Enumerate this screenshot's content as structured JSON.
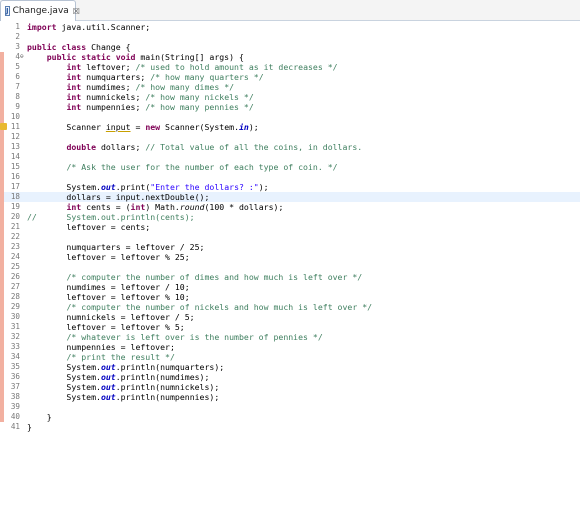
{
  "tab": {
    "title": "Change.java",
    "close": "☒"
  },
  "lines": [
    {
      "n": "1",
      "tokens": [
        {
          "t": "kw",
          "v": "import"
        },
        {
          "t": "p",
          "v": " java.util.Scanner;"
        }
      ]
    },
    {
      "n": "2",
      "tokens": []
    },
    {
      "n": "3",
      "tokens": [
        {
          "t": "kw",
          "v": "public class"
        },
        {
          "t": "p",
          "v": " Change {"
        }
      ]
    },
    {
      "n": "4",
      "fold": "⊖",
      "tokens": [
        {
          "t": "p",
          "v": "    "
        },
        {
          "t": "kw",
          "v": "public static void"
        },
        {
          "t": "p",
          "v": " main(String[] args) {"
        }
      ]
    },
    {
      "n": "5",
      "tokens": [
        {
          "t": "p",
          "v": "        "
        },
        {
          "t": "kw",
          "v": "int"
        },
        {
          "t": "p",
          "v": " leftover; "
        },
        {
          "t": "cm",
          "v": "/* used to hold amount as it decreases */"
        }
      ]
    },
    {
      "n": "6",
      "tokens": [
        {
          "t": "p",
          "v": "        "
        },
        {
          "t": "kw",
          "v": "int"
        },
        {
          "t": "p",
          "v": " numquarters; "
        },
        {
          "t": "cm",
          "v": "/* how many quarters */"
        }
      ]
    },
    {
      "n": "7",
      "tokens": [
        {
          "t": "p",
          "v": "        "
        },
        {
          "t": "kw",
          "v": "int"
        },
        {
          "t": "p",
          "v": " numdimes; "
        },
        {
          "t": "cm",
          "v": "/* how many dimes */"
        }
      ]
    },
    {
      "n": "8",
      "tokens": [
        {
          "t": "p",
          "v": "        "
        },
        {
          "t": "kw",
          "v": "int"
        },
        {
          "t": "p",
          "v": " numnickels; "
        },
        {
          "t": "cm",
          "v": "/* how many nickels */"
        }
      ]
    },
    {
      "n": "9",
      "tokens": [
        {
          "t": "p",
          "v": "        "
        },
        {
          "t": "kw",
          "v": "int"
        },
        {
          "t": "p",
          "v": " numpennies; "
        },
        {
          "t": "cm",
          "v": "/* how many pennies */"
        }
      ]
    },
    {
      "n": "10",
      "tokens": []
    },
    {
      "n": "11",
      "warn": true,
      "tokens": [
        {
          "t": "p",
          "v": "        Scanner "
        },
        {
          "t": "ul",
          "v": "input"
        },
        {
          "t": "p",
          "v": " = "
        },
        {
          "t": "kw",
          "v": "new"
        },
        {
          "t": "p",
          "v": " Scanner(System."
        },
        {
          "t": "sf",
          "v": "in"
        },
        {
          "t": "p",
          "v": ");"
        }
      ]
    },
    {
      "n": "12",
      "tokens": []
    },
    {
      "n": "13",
      "tokens": [
        {
          "t": "p",
          "v": "        "
        },
        {
          "t": "kw",
          "v": "double"
        },
        {
          "t": "p",
          "v": " dollars; "
        },
        {
          "t": "cm",
          "v": "// Total value of all the coins, in dollars."
        }
      ]
    },
    {
      "n": "14",
      "tokens": []
    },
    {
      "n": "15",
      "tokens": [
        {
          "t": "p",
          "v": "        "
        },
        {
          "t": "cm",
          "v": "/* Ask the user for the number of each type of coin. */"
        }
      ]
    },
    {
      "n": "16",
      "tokens": []
    },
    {
      "n": "17",
      "tokens": [
        {
          "t": "p",
          "v": "        System."
        },
        {
          "t": "sf",
          "v": "out"
        },
        {
          "t": "p",
          "v": ".print("
        },
        {
          "t": "st",
          "v": "\"Enter the dollars? :\""
        },
        {
          "t": "p",
          "v": ");"
        }
      ]
    },
    {
      "n": "18",
      "current": true,
      "tokens": [
        {
          "t": "p",
          "v": "        dollars = input.nextDouble();"
        }
      ]
    },
    {
      "n": "19",
      "tokens": [
        {
          "t": "p",
          "v": "        "
        },
        {
          "t": "kw",
          "v": "int"
        },
        {
          "t": "p",
          "v": " cents = ("
        },
        {
          "t": "kw",
          "v": "int"
        },
        {
          "t": "p",
          "v": ") Math."
        },
        {
          "t": "i",
          "v": "round"
        },
        {
          "t": "p",
          "v": "(100 * dollars);"
        }
      ]
    },
    {
      "n": "20",
      "tokens": [
        {
          "t": "cm",
          "v": "//      System.out.println(cents);"
        }
      ]
    },
    {
      "n": "21",
      "tokens": [
        {
          "t": "p",
          "v": "        leftover = cents;"
        }
      ]
    },
    {
      "n": "22",
      "tokens": []
    },
    {
      "n": "23",
      "tokens": [
        {
          "t": "p",
          "v": "        numquarters = leftover / 25;"
        }
      ]
    },
    {
      "n": "24",
      "tokens": [
        {
          "t": "p",
          "v": "        leftover = leftover % 25;"
        }
      ]
    },
    {
      "n": "25",
      "tokens": []
    },
    {
      "n": "26",
      "tokens": [
        {
          "t": "p",
          "v": "        "
        },
        {
          "t": "cm",
          "v": "/* computer the number of dimes and how much is left over */"
        }
      ]
    },
    {
      "n": "27",
      "tokens": [
        {
          "t": "p",
          "v": "        numdimes = leftover / 10;"
        }
      ]
    },
    {
      "n": "28",
      "tokens": [
        {
          "t": "p",
          "v": "        leftover = leftover % 10;"
        }
      ]
    },
    {
      "n": "29",
      "tokens": [
        {
          "t": "p",
          "v": "        "
        },
        {
          "t": "cm",
          "v": "/* computer the number of nickels and how much is left over */"
        }
      ]
    },
    {
      "n": "30",
      "tokens": [
        {
          "t": "p",
          "v": "        numnickels = leftover / 5;"
        }
      ]
    },
    {
      "n": "31",
      "tokens": [
        {
          "t": "p",
          "v": "        leftover = leftover % 5;"
        }
      ]
    },
    {
      "n": "32",
      "tokens": [
        {
          "t": "p",
          "v": "        "
        },
        {
          "t": "cm",
          "v": "/* whatever is left over is the number of pennies */"
        }
      ]
    },
    {
      "n": "33",
      "tokens": [
        {
          "t": "p",
          "v": "        numpennies = leftover;"
        }
      ]
    },
    {
      "n": "34",
      "tokens": [
        {
          "t": "p",
          "v": "        "
        },
        {
          "t": "cm",
          "v": "/* print the result */"
        }
      ]
    },
    {
      "n": "35",
      "tokens": [
        {
          "t": "p",
          "v": "        System."
        },
        {
          "t": "sf",
          "v": "out"
        },
        {
          "t": "p",
          "v": ".println(numquarters);"
        }
      ]
    },
    {
      "n": "36",
      "tokens": [
        {
          "t": "p",
          "v": "        System."
        },
        {
          "t": "sf",
          "v": "out"
        },
        {
          "t": "p",
          "v": ".println(numdimes);"
        }
      ]
    },
    {
      "n": "37",
      "tokens": [
        {
          "t": "p",
          "v": "        System."
        },
        {
          "t": "sf",
          "v": "out"
        },
        {
          "t": "p",
          "v": ".println(numnickels);"
        }
      ]
    },
    {
      "n": "38",
      "tokens": [
        {
          "t": "p",
          "v": "        System."
        },
        {
          "t": "sf",
          "v": "out"
        },
        {
          "t": "p",
          "v": ".println(numpennies);"
        }
      ]
    },
    {
      "n": "39",
      "tokens": []
    },
    {
      "n": "40",
      "tokens": [
        {
          "t": "p",
          "v": "    }"
        }
      ]
    },
    {
      "n": "41",
      "tokens": [
        {
          "t": "p",
          "v": "}"
        }
      ]
    }
  ]
}
